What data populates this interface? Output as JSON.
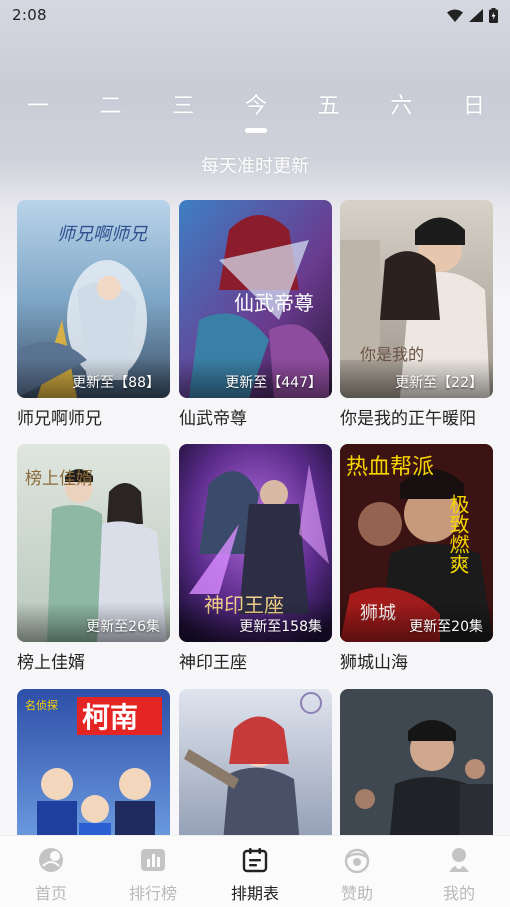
{
  "status_bar": {
    "time": "2:08"
  },
  "weekdays": [
    "一",
    "二",
    "三",
    "今",
    "五",
    "六",
    "日"
  ],
  "active_day_index": 3,
  "subtitle": "每天准时更新",
  "cards": [
    {
      "title": "师兄啊师兄",
      "badge": "更新至【88】"
    },
    {
      "title": "仙武帝尊",
      "badge": "更新至【447】"
    },
    {
      "title": "你是我的正午暖阳",
      "badge": "更新至【22】"
    },
    {
      "title": "榜上佳婿",
      "badge": "更新至26集"
    },
    {
      "title": "神印王座",
      "badge": "更新至158集"
    },
    {
      "title": "狮城山海",
      "badge": "更新至20集"
    },
    {
      "title": "",
      "badge": ""
    },
    {
      "title": "",
      "badge": ""
    },
    {
      "title": "",
      "badge": ""
    }
  ],
  "poster_texts": {
    "p1": "师兄啊师兄",
    "p2": "仙武帝尊",
    "p3": "你是我的",
    "p4": "榜上佳婿",
    "p5": "神印王座",
    "p6a": "热血帮派",
    "p6b": "极致燃爽",
    "p6c": "狮城",
    "p7": "柯南",
    "p7b": "名侦探"
  },
  "bottom_nav": [
    {
      "label": "首页",
      "icon": "home-icon"
    },
    {
      "label": "排行榜",
      "icon": "ranking-icon"
    },
    {
      "label": "排期表",
      "icon": "schedule-icon"
    },
    {
      "label": "赞助",
      "icon": "sponsor-icon"
    },
    {
      "label": "我的",
      "icon": "profile-icon"
    }
  ],
  "active_nav_index": 2,
  "colors": {
    "active_nav": "#222222",
    "inactive_nav": "#b9b9b9"
  }
}
